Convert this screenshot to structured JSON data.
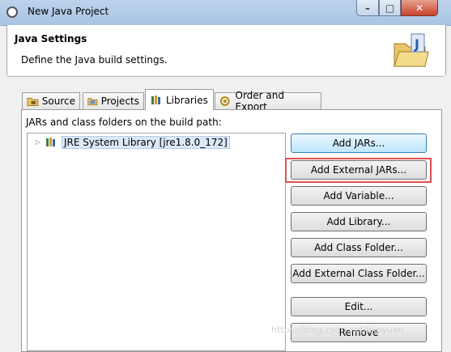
{
  "window": {
    "title": "New Java Project",
    "controls": {
      "minimize": "–",
      "maximize": "□",
      "close": "✕"
    }
  },
  "header": {
    "title": "Java Settings",
    "description": "Define the Java build settings."
  },
  "tabs": [
    {
      "label": "Source",
      "icon": "source-folder-icon",
      "active": false
    },
    {
      "label": "Projects",
      "icon": "projects-icon",
      "active": false
    },
    {
      "label": "Libraries",
      "icon": "libraries-icon",
      "active": true
    },
    {
      "label": "Order and Export",
      "icon": "order-export-icon",
      "active": false
    }
  ],
  "libraries": {
    "section_label": "JARs and class folders on the build path:",
    "tree_items": [
      {
        "label": "JRE System Library [jre1.8.0_172]",
        "icon": "jre-library-icon",
        "expanded": false
      }
    ],
    "buttons": {
      "add_jars": "Add JARs...",
      "add_external_jars": "Add External JARs...",
      "add_variable": "Add Variable...",
      "add_library": "Add Library...",
      "add_class_folder": "Add Class Folder...",
      "add_external_class_folder": "Add External Class Folder...",
      "edit": "Edit...",
      "remove": "Remove"
    }
  },
  "highlight": {
    "target": "add_external_jars",
    "color": "#d9534f"
  },
  "watermark": "https://blog.csdn.net/jsjpyuan"
}
